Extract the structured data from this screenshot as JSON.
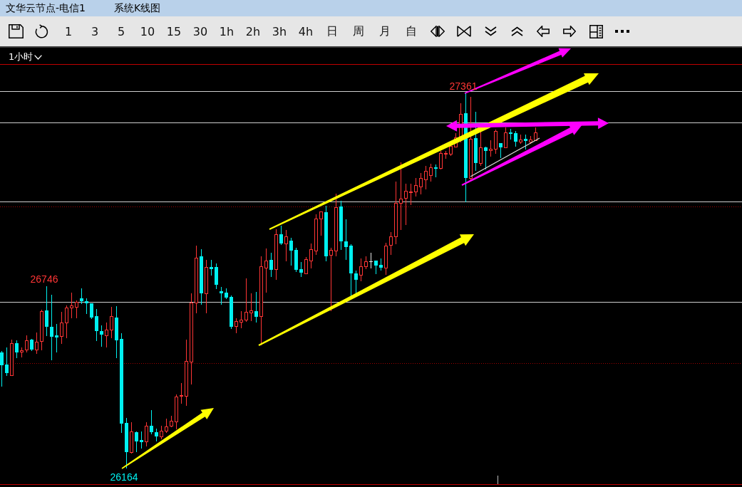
{
  "title_bar": {
    "title": "文华云节点-电信1",
    "view": "系统K线图"
  },
  "toolbar": {
    "periods": [
      "1",
      "3",
      "5",
      "10",
      "15",
      "30",
      "1h",
      "2h",
      "3h",
      "4h",
      "日",
      "周",
      "月",
      "自"
    ]
  },
  "chart": {
    "period_selector": "1小时",
    "price_labels": [
      {
        "kind": "high",
        "text": "27361"
      },
      {
        "kind": "high",
        "text": "26746"
      },
      {
        "kind": "low",
        "text": "26164"
      }
    ]
  }
}
